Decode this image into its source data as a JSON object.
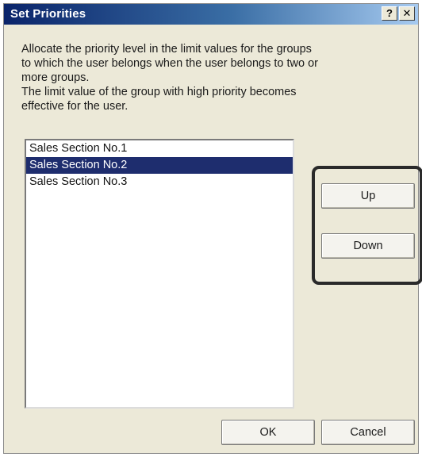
{
  "dialog": {
    "title": "Set Priorities",
    "help_label": "?",
    "close_label": "✕"
  },
  "description": {
    "line1": "Allocate the priority level in the limit values for the groups",
    "line2": "to which the user belongs when the user belongs to two or",
    "line3": "more groups.",
    "line4": "The limit value of the group with high priority becomes",
    "line5": "effective for the user."
  },
  "groups": {
    "items": [
      {
        "label": "Sales Section No.1",
        "selected": false
      },
      {
        "label": "Sales Section No.2",
        "selected": true
      },
      {
        "label": "Sales Section No.3",
        "selected": false
      }
    ]
  },
  "buttons": {
    "up": "Up",
    "down": "Down",
    "ok": "OK",
    "cancel": "Cancel"
  },
  "colors": {
    "selection": "#1e2d6e",
    "title_bar": "#0a246a",
    "highlight_frame": "#2a2a2a"
  }
}
